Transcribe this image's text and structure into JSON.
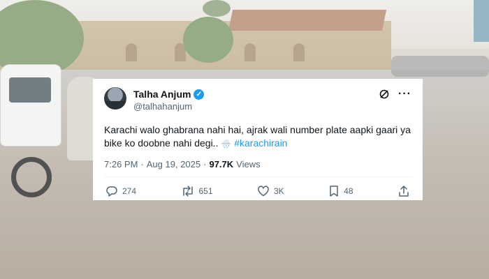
{
  "tweet": {
    "display_name": "Talha Anjum",
    "handle": "@talhahanjum",
    "text": "Karachi walo ghabrana nahi hai, ajrak wali number plate aapki gaari ya bike ko doobne nahi degi..",
    "emoji": "🌧️",
    "hashtag": "#karachirain",
    "time": "7:26 PM",
    "separator": "·",
    "date": "Aug 19, 2025",
    "views_count": "97.7K",
    "views_label": "Views",
    "more_glyph": "···"
  },
  "actions": {
    "replies": "274",
    "retweets": "651",
    "likes": "3K",
    "bookmarks": "48"
  },
  "colors": {
    "accent": "#1d9bf0",
    "text_primary": "#0f1419",
    "text_secondary": "#536471"
  },
  "icons": [
    "verified-badge-icon",
    "grok-icon",
    "more-icon",
    "reply-icon",
    "retweet-icon",
    "like-icon",
    "bookmark-icon",
    "share-icon"
  ]
}
